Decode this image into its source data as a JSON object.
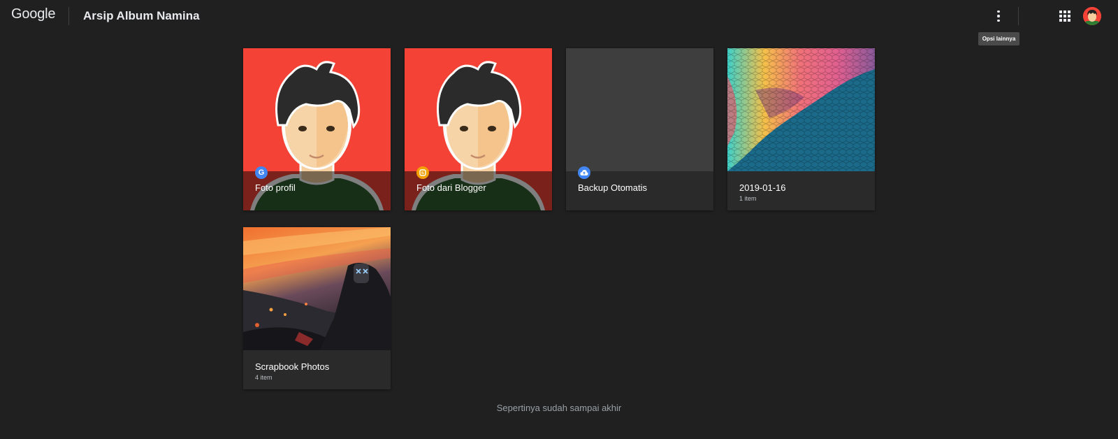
{
  "header": {
    "logo_text": "Google",
    "page_title": "Arsip Album Namina",
    "tooltip": "Opsi lainnya"
  },
  "albums": [
    {
      "title": "Foto profil",
      "count": "",
      "badge": "google-icon",
      "cover": "avatar-illustration"
    },
    {
      "title": "Foto dari Blogger",
      "count": "",
      "badge": "blogger-icon",
      "cover": "avatar-illustration"
    },
    {
      "title": "Backup Otomatis",
      "count": "",
      "badge": "cloud-upload-icon",
      "cover": "empty"
    },
    {
      "title": "2019-01-16",
      "count": "1 item",
      "badge": "",
      "cover": "hexagon-pattern"
    },
    {
      "title": "Scrapbook Photos",
      "count": "4 item",
      "badge": "",
      "cover": "sunset-masked-person"
    }
  ],
  "footer": {
    "end_message": "Sepertinya sudah sampai akhir"
  },
  "colors": {
    "background": "#202020",
    "card": "#2a2a2a",
    "avatar_red": "#f44336",
    "google_blue": "#4285f4",
    "blogger_orange": "#f4a100"
  }
}
